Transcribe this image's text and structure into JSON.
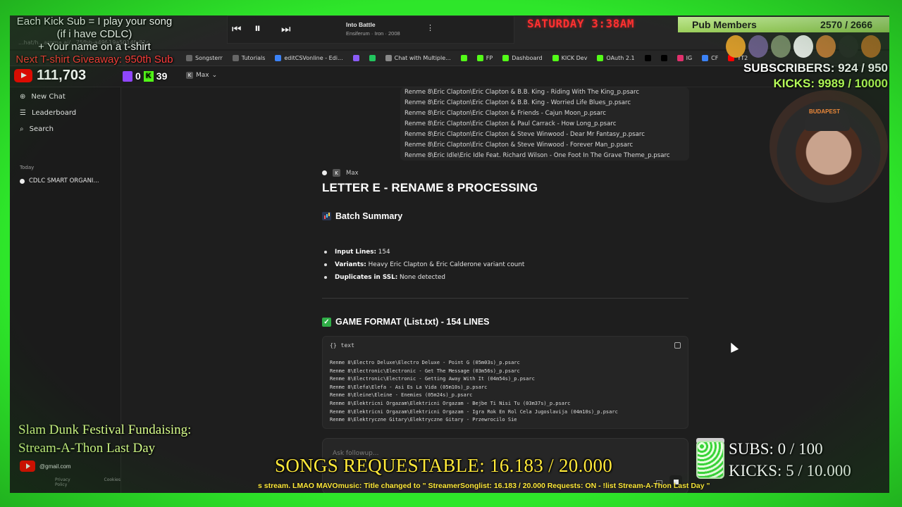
{
  "stream": {
    "kick_sub_lines": [
      "Each Kick Sub = I play your song",
      "(if i have CDLC)",
      "+ Your name on a t-shirt"
    ],
    "giveaway": "Next T-shirt Giveaway: 950th Sub",
    "youtube_count": "111,703",
    "twitch_count": "0",
    "kick_count": "39",
    "player": {
      "title": "Into Battle",
      "subtitle": "Ensiferum · Iron · 2008"
    },
    "clock": "SATURDAY 3:38AM",
    "pub_members": {
      "label": "Pub Members",
      "value": "2570 / 2666"
    },
    "subscribers": "SUBSCRIBERS: 924 / 950",
    "kicks": "KICKS: 9989 / 10000",
    "fundraise_lines": [
      "Slam Dunk Festival Fundaising:",
      "Stream-A-Thon Last Day"
    ],
    "email": "@gmail.com",
    "songs_requestable": "SONGS REQUESTABLE: 16.183 / 20.000",
    "ticker": "s stream. LMAO  MAVOmusic: Title changed to \" StreamerSonglist: 16.183 / 20.000  Requests: ON - !list  Stream-A-Thon Last Day \"",
    "subs_goal": "SUBS:  0 / 100",
    "kicks_goal": "KICKS: 5 / 10.000",
    "beanie_text": "BUDAPEST"
  },
  "browser": {
    "url_fragment": "...hat/h...aroma.ai/...75fbb-a49f-19a5014fe81c",
    "bookmarks": [
      {
        "label": "Songsterr",
        "color": "#666"
      },
      {
        "label": "Tutorials",
        "color": "#666"
      },
      {
        "label": "editCSVonline - Edi...",
        "color": "#3b82f6"
      },
      {
        "label": "",
        "color": "#8b5cf6"
      },
      {
        "label": "",
        "color": "#22c55e"
      },
      {
        "label": "Chat with Multiple...",
        "color": "#888"
      },
      {
        "label": "",
        "color": "#53fc18"
      },
      {
        "label": "FP",
        "color": "#53fc18"
      },
      {
        "label": "Dashboard",
        "color": "#53fc18"
      },
      {
        "label": "KICK Dev",
        "color": "#53fc18"
      },
      {
        "label": "OAuth 2.1",
        "color": "#53fc18"
      },
      {
        "label": "",
        "color": "#000"
      },
      {
        "label": "",
        "color": "#000"
      },
      {
        "label": "IG",
        "color": "#e1306c"
      },
      {
        "label": "CF",
        "color": "#3b82f6"
      },
      {
        "label": "YT2",
        "color": "#ff0000"
      }
    ],
    "model": "Max"
  },
  "sidebar": {
    "items": [
      {
        "label": "New Chat",
        "icon": "plus-icon"
      },
      {
        "label": "Leaderboard",
        "icon": "list-icon"
      },
      {
        "label": "Search",
        "icon": "search-icon"
      }
    ],
    "today_label": "Today",
    "chat_item": "CDLC SMART ORGANI...",
    "footer": [
      "Privacy Policy",
      "Cookies"
    ]
  },
  "chat": {
    "previous_lines": [
      "Renme 8\\Eric Clapton\\Eric Clapton & B.B. King - Riding With The King_p.psarc",
      "Renme 8\\Eric Clapton\\Eric Clapton & B.B. King - Worried Life Blues_p.psarc",
      "Renme 8\\Eric Clapton\\Eric Clapton & Friends - Cajun Moon_p.psarc",
      "Renme 8\\Eric Clapton\\Eric Clapton & Paul Carrack - How Long_p.psarc",
      "Renme 8\\Eric Clapton\\Eric Clapton & Steve Winwood - Dear Mr Fantasy_p.psarc",
      "Renme 8\\Eric Clapton\\Eric Clapton & Steve Winwood - Forever Man_p.psarc",
      "Renme 8\\Eric Idle\\Eric Idle Feat. Richard Wilson - One Foot In The Grave Theme_p.psarc"
    ],
    "assistant_name": "Max",
    "title": "LETTER E - RENAME 8 PROCESSING",
    "batch_heading": "Batch Summary",
    "bullets": [
      {
        "label": "Input Lines:",
        "value": " 154"
      },
      {
        "label": "Variants:",
        "value": " Heavy Eric Clapton & Eric Calderone variant count"
      },
      {
        "label": "Duplicates in SSL:",
        "value": " None detected"
      }
    ],
    "game_heading": "GAME FORMAT (List.txt) - 154 LINES",
    "code_lang": "text",
    "code_lines": [
      "Renme 8\\Electro Deluxe\\Electro Deluxe - Point G (05m03s)_p.psarc",
      "Renme 8\\Electronic\\Electronic - Get The Message (03m56s)_p.psarc",
      "Renme 8\\Electronic\\Electronic - Getting Away With It (04m54s)_p.psarc",
      "Renme 8\\Elefa\\Elefa - Asi Es La Vida (05m10s)_p.psarc",
      "Renme 8\\Eleine\\Eleine - Enemies (05m24s)_p.psarc",
      "Renme 8\\Elektricni Orgazam\\Elektricni Orgazam - Bejbe Ti Nisi Tu (03m37s)_p.psarc",
      "Renme 8\\Elektricni Orgazam\\Elektricni Orgazam - Igra Rok En Rol Cela Jugoslavija (04m10s)_p.psarc",
      "Renme 8\\Elektryczne Gitary\\Elektryczne Gitary - Przewrocilo Sie"
    ],
    "ask_placeholder": "Ask followup..."
  }
}
